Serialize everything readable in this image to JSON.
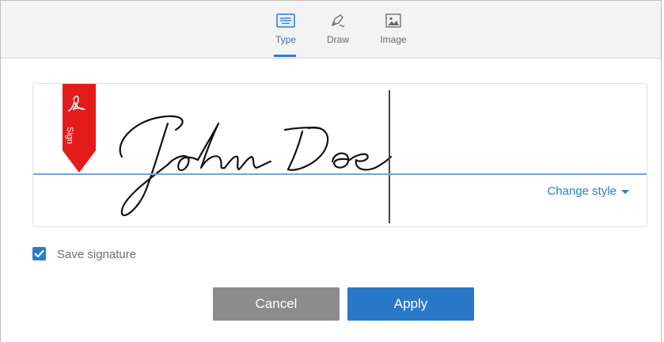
{
  "tabs": [
    {
      "label": "Type",
      "icon": "keyboard-icon",
      "active": true
    },
    {
      "label": "Draw",
      "icon": "pen-icon",
      "active": false
    },
    {
      "label": "Image",
      "icon": "image-icon",
      "active": false
    }
  ],
  "signature": {
    "text": "John Doe",
    "badge_label": "Sign",
    "badge_color": "#e21b1b",
    "change_style_label": "Change style"
  },
  "save_signature": {
    "label": "Save signature",
    "checked": true
  },
  "buttons": {
    "cancel_label": "Cancel",
    "apply_label": "Apply"
  },
  "colors": {
    "accent": "#2b7bd4",
    "cancel_bg": "#8c8c8c",
    "apply_bg": "#2a78c8"
  }
}
